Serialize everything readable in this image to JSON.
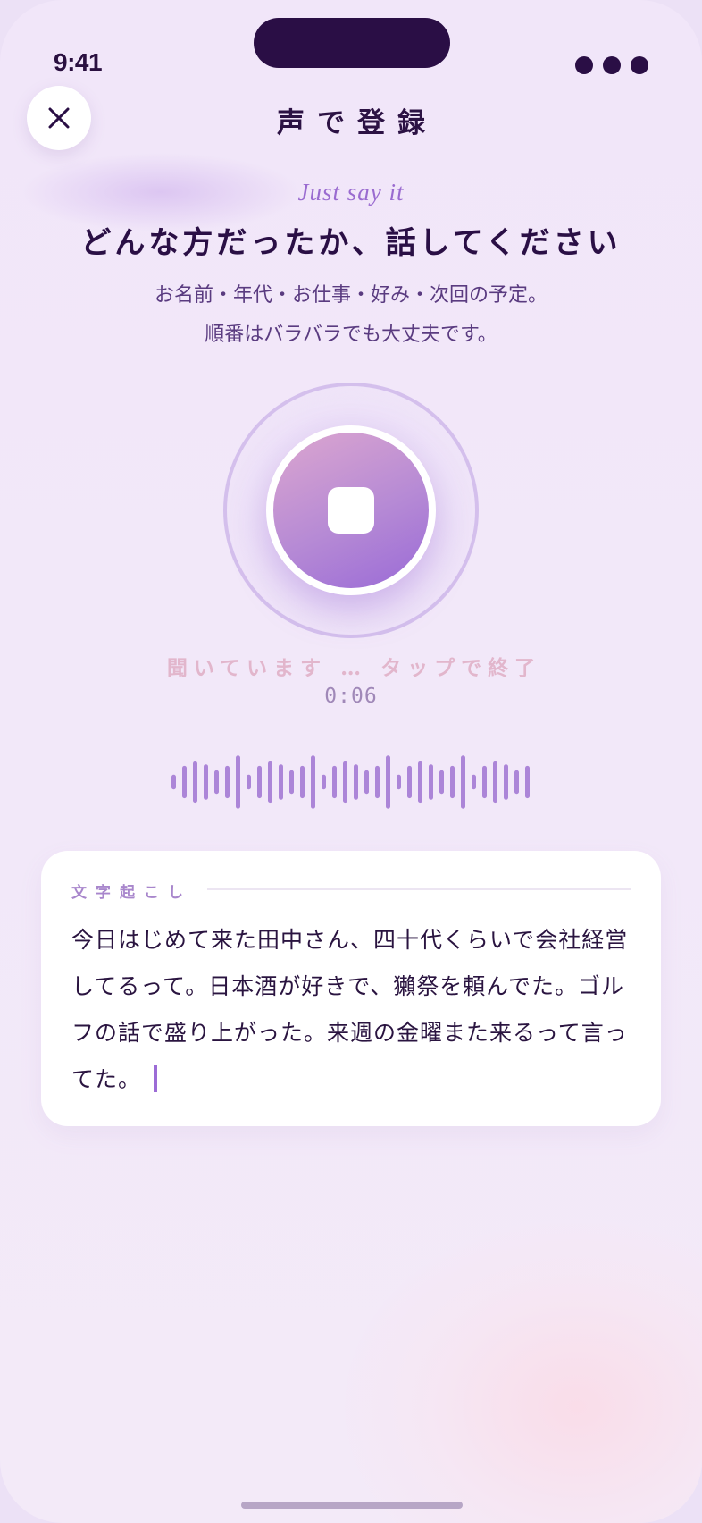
{
  "status_bar": {
    "time": "9:41",
    "menu_icon": "more-dots-icon"
  },
  "header": {
    "close_icon": "close-icon",
    "title": "声で登録"
  },
  "intro": {
    "eyebrow": "Just say it",
    "headline": "どんな方だったか、話してください",
    "subtext_line1": "お名前・年代・お仕事・好み・次回の予定。",
    "subtext_line2": "順番はバラバラでも大丈夫です。"
  },
  "recorder": {
    "button_icon": "stop-icon",
    "status": "聞いています … タップで終了",
    "elapsed": "0:06",
    "waveform_levels": [
      0.25,
      0.55,
      0.7,
      0.6,
      0.4,
      0.55,
      0.9,
      0.25,
      0.55,
      0.7,
      0.6,
      0.4,
      0.55,
      0.9,
      0.25,
      0.55,
      0.7,
      0.6,
      0.4,
      0.55,
      0.9,
      0.25,
      0.55,
      0.7,
      0.6,
      0.4,
      0.55,
      0.9,
      0.25,
      0.55,
      0.7,
      0.6,
      0.4,
      0.55
    ]
  },
  "transcript": {
    "label": "文字起こし",
    "text": "今日はじめて来た田中さん、四十代くらいで会社経営してるって。日本酒が好きで、獺祭を頼んでた。ゴルフの話で盛り上がった。来週の金曜また来るって言ってた。"
  },
  "colors": {
    "accent": "#9a6ad6",
    "ink": "#2a0f45",
    "background": "#f1e6f9",
    "status_pink": "#e2b6cc"
  }
}
